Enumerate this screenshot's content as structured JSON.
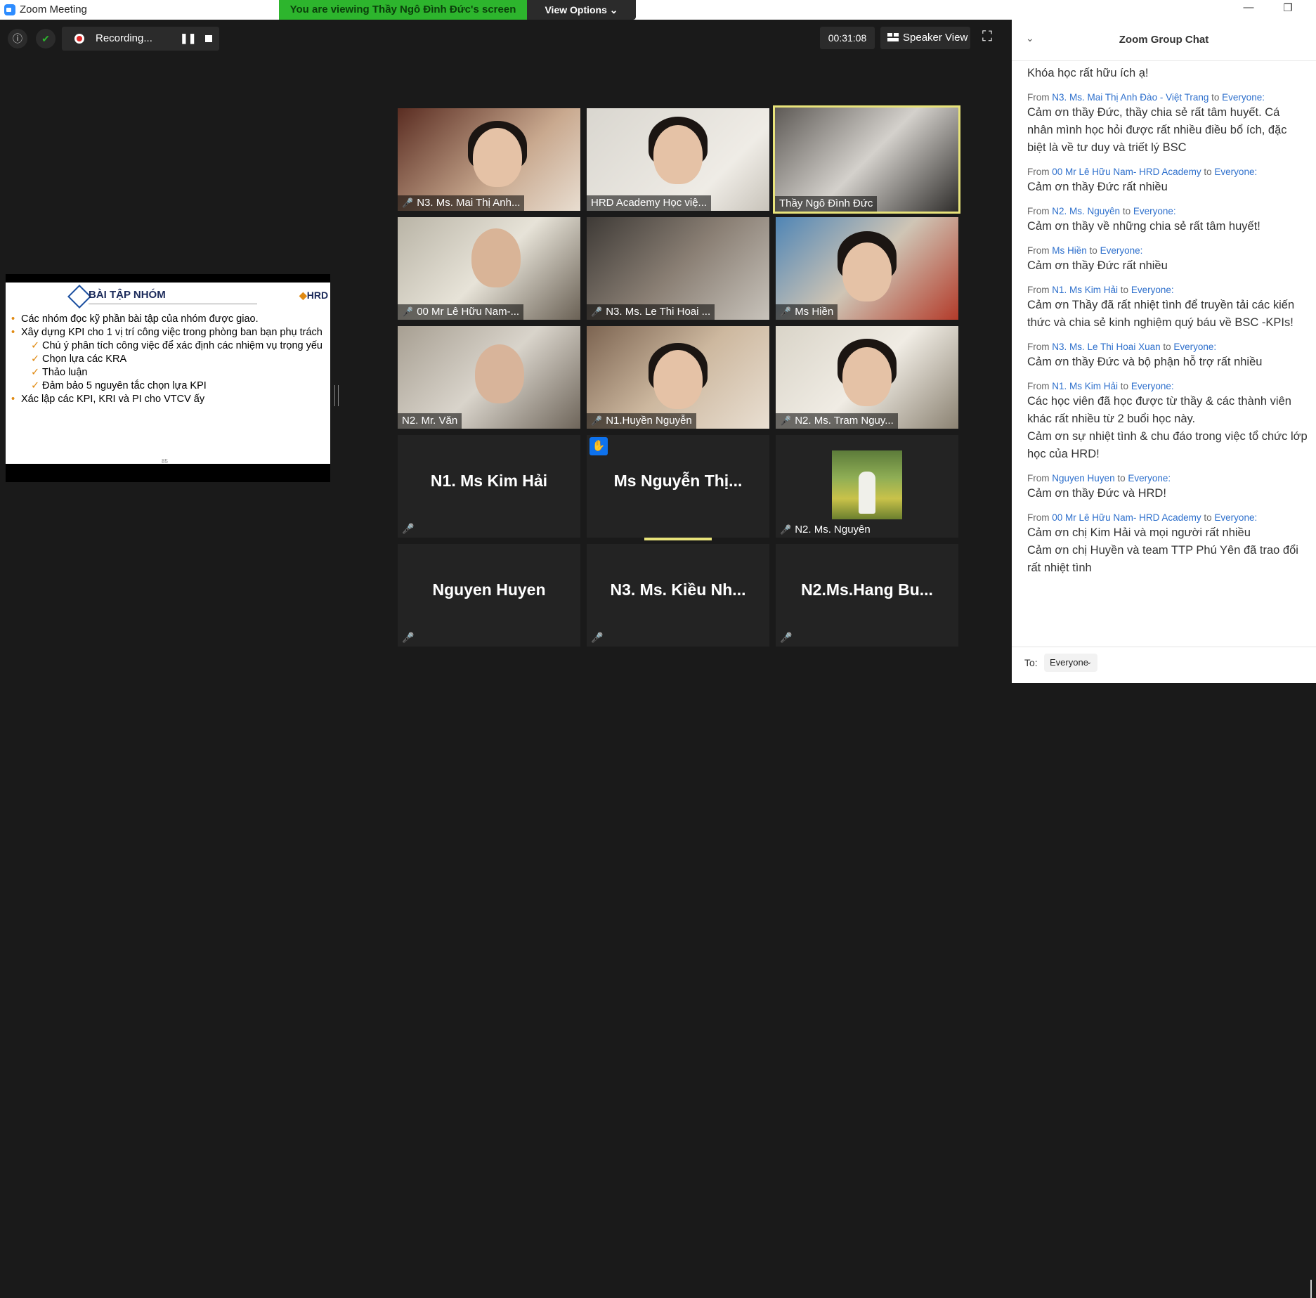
{
  "window": {
    "title": "Zoom Meeting",
    "minimize": "—",
    "restore": "❐"
  },
  "share_banner": {
    "viewing": "You are viewing Thầy Ngô Đình Đức's screen",
    "view_options": "View Options ⌄"
  },
  "toolbar": {
    "info_glyph": "ⓘ",
    "shield_glyph": "✔",
    "recording_label": "Recording...",
    "pause_glyph": "❚❚",
    "timer": "00:31:08",
    "speaker_view": "Speaker View",
    "fullscreen_glyph": "⛶"
  },
  "slide": {
    "title": "BÀI TẬP NHÓM",
    "logo_prefix": "◆",
    "logo": "HRD",
    "page_number": "85",
    "items": [
      "Các nhóm đọc kỹ phần bài tập của nhóm được giao.",
      "Xây dựng KPI cho 1 vị trí công việc trong phòng ban bạn phụ trách",
      "Chú ý phân tích công việc để xác định các nhiệm vụ trọng yếu",
      "Chọn lựa các KRA",
      "Thảo luận",
      "Đảm bảo 5 nguyên tắc chọn lựa KPI",
      "Xác lập các KPI, KRI và PI cho VTCV ấy"
    ]
  },
  "mic_glyph": "🎤",
  "hand_glyph": "✋",
  "participants": {
    "p1": "N3. Ms. Mai Thị Anh...",
    "p2": "HRD Academy Học việ...",
    "p3": "Thầy Ngô Đình Đức",
    "p4": "00 Mr Lê Hữu Nam-...",
    "p5": "N3. Ms. Le Thi Hoai ...",
    "p6": "Ms Hiền",
    "p7": "N2. Mr. Văn",
    "p8": "N1.Huyền Nguyễn",
    "p9": "N2. Ms. Tram Nguy...",
    "p10": "N1. Ms Kim Hải",
    "p11": "Ms  Nguyễn  Thị...",
    "p12": "N2. Ms. Nguyên",
    "p13": "Nguyen Huyen",
    "p14": "N3.  Ms.  Kiều  Nh...",
    "p15": "N2.Ms.Hang  Bu..."
  },
  "chat": {
    "title": "Zoom Group Chat",
    "chevron": "⌄",
    "first_message": "Khóa học rất hữu ích ạ!",
    "from_label": "From",
    "to_label": "to",
    "everyone": "Everyone:",
    "messages": [
      {
        "sender": "N3. Ms. Mai Thị Anh Đào - Việt Trang",
        "lines": [
          "Cảm ơn thầy Đức, thầy chia sẻ rất tâm huyết. Cá nhân mình học hỏi được rất nhiều điều bổ ích, đặc biệt là về tư duy và triết lý BSC"
        ]
      },
      {
        "sender": "00 Mr Lê Hữu Nam- HRD Academy",
        "lines": [
          "Cảm ơn thầy Đức rất nhiều"
        ]
      },
      {
        "sender": "N2. Ms. Nguyên",
        "lines": [
          "Cảm ơn thầy về những chia sẻ rất tâm huyết!"
        ]
      },
      {
        "sender": "Ms Hiền",
        "lines": [
          "Cảm ơn thầy Đức rất nhiều"
        ]
      },
      {
        "sender": "N1. Ms Kim Hải",
        "lines": [
          "Cảm ơn Thầy đã rất nhiệt tình để truyền tải các kiến thức và chia sẻ kinh nghiệm quý báu về BSC -KPIs!"
        ]
      },
      {
        "sender": "N3. Ms. Le Thi Hoai Xuan",
        "lines": [
          "Cảm ơn thầy Đức và bộ phận hỗ trợ rất nhiều"
        ]
      },
      {
        "sender": "N1. Ms Kim Hải",
        "lines": [
          "Các học viên đã học được từ thầy & các thành viên khác rất nhiều từ 2 buổi học này.",
          "Cảm ơn sự nhiệt tình & chu đáo trong việc tổ chức lớp học của HRD!"
        ]
      },
      {
        "sender": "Nguyen Huyen",
        "lines": [
          "Cảm ơn thầy Đức và HRD!"
        ]
      },
      {
        "sender": "00 Mr Lê Hữu Nam- HRD Academy",
        "lines": [
          "Cảm ơn chị Kim Hải và mọi người rất nhiều",
          "Cảm ơn chị Huyền và team TTP Phú Yên đã trao đổi rất nhiệt tình"
        ]
      }
    ],
    "footer_to": "To:",
    "recipient": "Everyone",
    "recipient_caret": "⌄"
  }
}
